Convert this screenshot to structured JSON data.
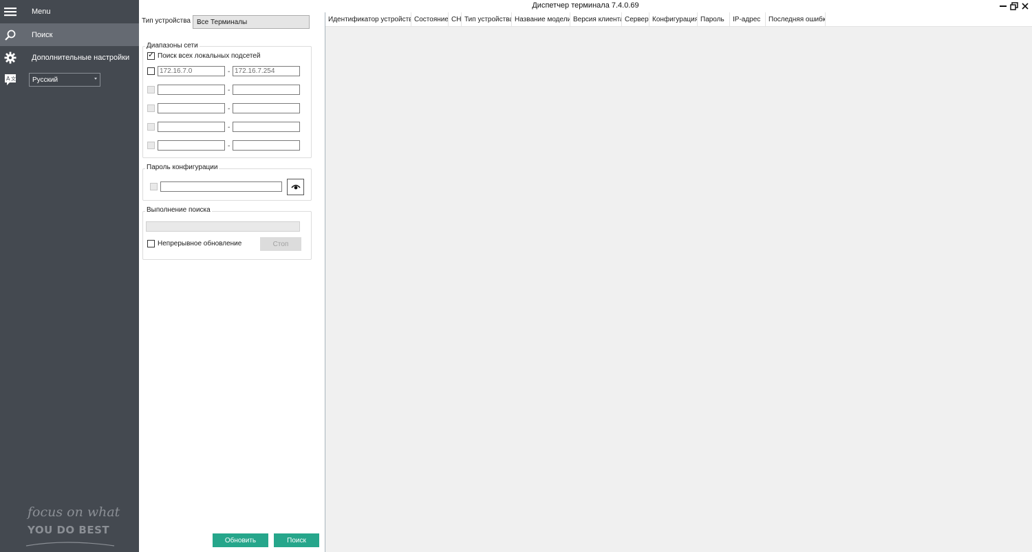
{
  "window": {
    "title": "Диспетчер терминала  7.4.0.69"
  },
  "sidebar": {
    "menu_label": "Menu",
    "items": [
      {
        "label": "Поиск",
        "icon": "search-icon",
        "active": true
      },
      {
        "label": "Дополнительные настройки",
        "icon": "gear-icon",
        "active": false
      }
    ],
    "language": {
      "icon": "language-icon",
      "value": "Русский"
    },
    "slogan": {
      "line1": "focus on what",
      "line2": "YOU DO BEST"
    }
  },
  "search_panel": {
    "device_type_label": "Тип устройства",
    "device_type_value": "Все Терминалы",
    "network_ranges": {
      "legend": "Диапазоны сети",
      "search_all_local_label": "Поиск всех локальных подсетей",
      "search_all_local_checked": true,
      "ranges": [
        {
          "from": "172.16.7.0",
          "to": "172.16.7.254",
          "enabled": true
        },
        {
          "from": "",
          "to": "",
          "enabled": false
        },
        {
          "from": "",
          "to": "",
          "enabled": false
        },
        {
          "from": "",
          "to": "",
          "enabled": false
        },
        {
          "from": "",
          "to": "",
          "enabled": false
        }
      ],
      "separator": "-"
    },
    "config_password": {
      "legend": "Пароль конфигурации",
      "value": "",
      "show_icon": "eye-icon"
    },
    "search_progress": {
      "legend": "Выполнение поиска",
      "progress": 0,
      "continuous_update_label": "Непрерывное обновление",
      "continuous_update_checked": false,
      "stop_label": "Стоп"
    },
    "refresh_label": "Обновить",
    "search_label": "Поиск"
  },
  "device_table": {
    "columns": [
      "Идентификатор устройства",
      "Состояние",
      "СН",
      "Тип устройства",
      "Название модели",
      "Версия клиента",
      "Сервер",
      "Конфигурация",
      "Пароль",
      "IP-адрес",
      "Последняя ошибка"
    ],
    "rows": []
  },
  "colors": {
    "sidebar_bg": "#444950",
    "sidebar_active": "#656a72",
    "accent": "#26a68b",
    "grid_bg": "#f0f0f0"
  }
}
